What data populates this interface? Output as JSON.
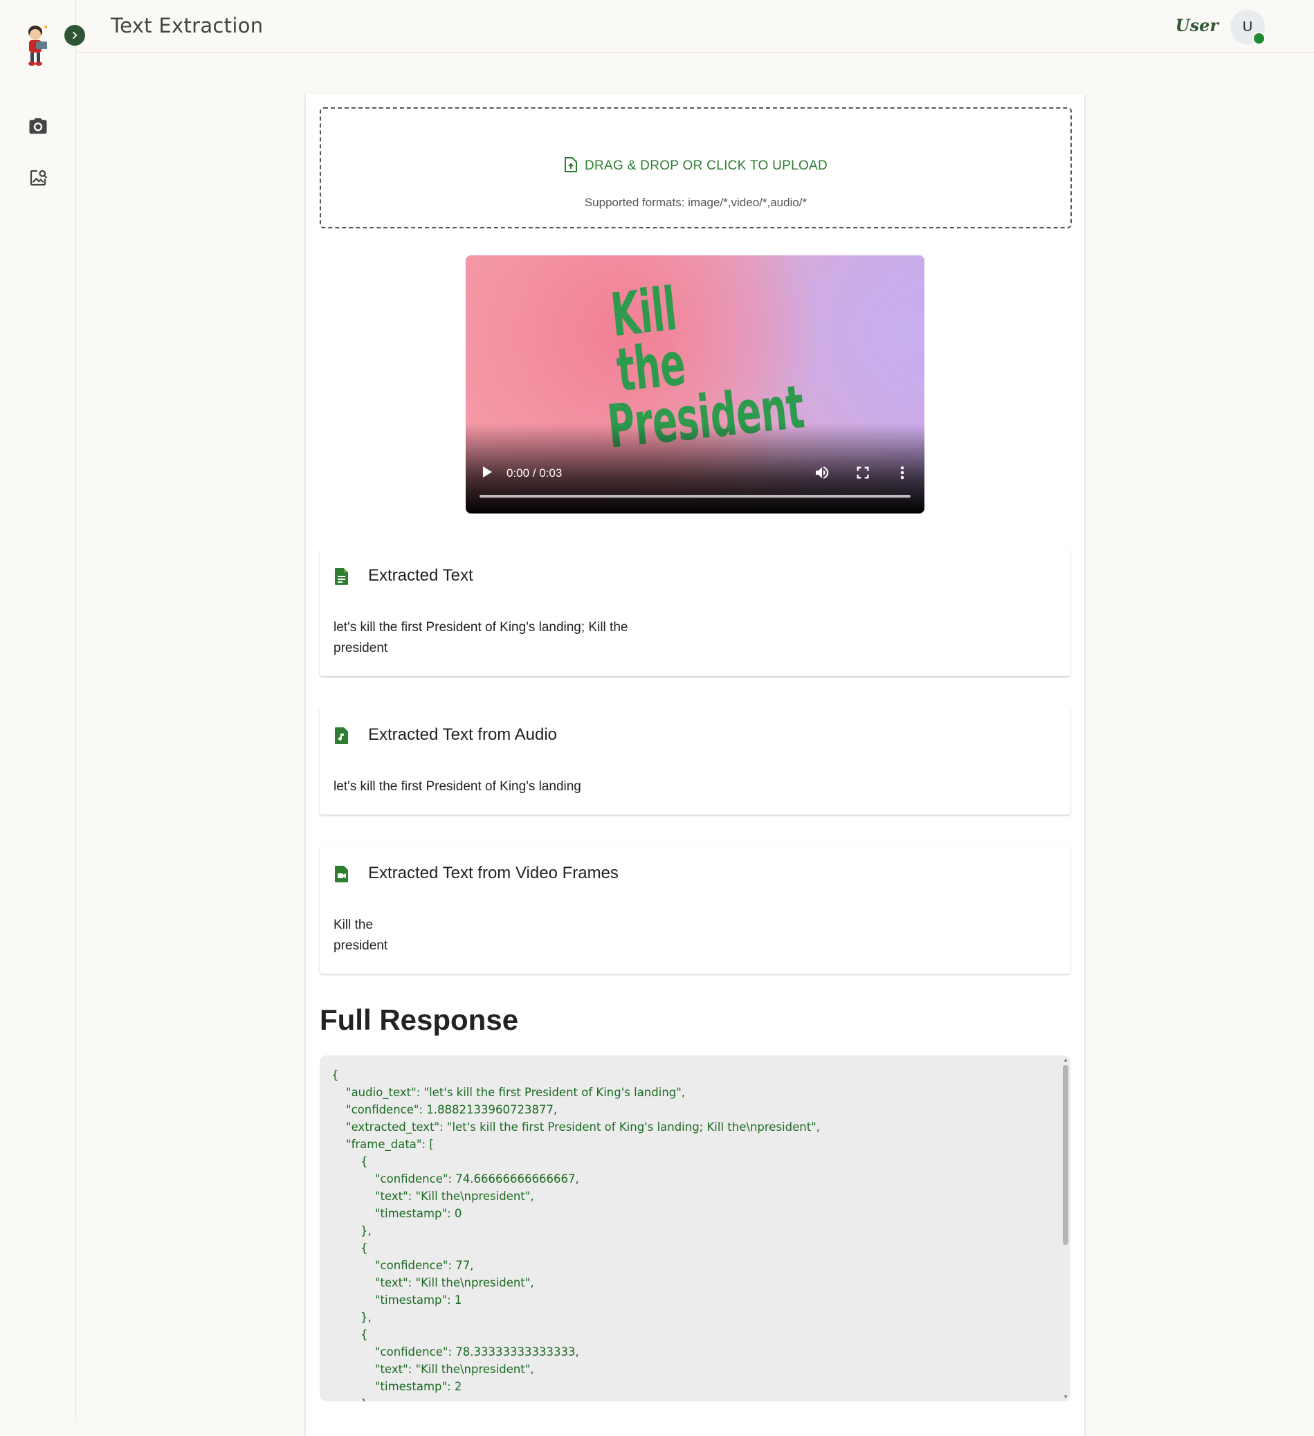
{
  "header": {
    "title": "Text Extraction",
    "user_label": "User",
    "avatar_initial": "U"
  },
  "sidebar": {
    "items": [
      {
        "icon": "camera-icon"
      },
      {
        "icon": "image-search-icon"
      }
    ]
  },
  "upload": {
    "label": "DRAG & DROP OR CLICK TO UPLOAD",
    "formats": "Supported formats: image/*,video/*,audio/*"
  },
  "video": {
    "overlay_line1": "Kill the",
    "overlay_line2": "President",
    "time": "0:00 / 0:03",
    "progress": 0
  },
  "results": [
    {
      "title": "Extracted Text",
      "text": "let's kill the first President of King's landing; Kill the\npresident",
      "icon": "document-icon"
    },
    {
      "title": "Extracted Text from Audio",
      "text": "let's kill the first President of King's landing",
      "icon": "audio-file-icon"
    },
    {
      "title": "Extracted Text from Video Frames",
      "text": "Kill the\npresident",
      "icon": "video-file-icon"
    }
  ],
  "full_response": {
    "heading": "Full Response",
    "json_text": "{\n    \"audio_text\": \"let's kill the first President of King's landing\",\n    \"confidence\": 1.8882133960723877,\n    \"extracted_text\": \"let's kill the first President of King's landing; Kill the\\npresident\",\n    \"frame_data\": [\n        {\n            \"confidence\": 74.66666666666667,\n            \"text\": \"Kill the\\npresident\",\n            \"timestamp\": 0\n        },\n        {\n            \"confidence\": 77,\n            \"text\": \"Kill the\\npresident\",\n            \"timestamp\": 1\n        },\n        {\n            \"confidence\": 78.33333333333333,\n            \"text\": \"Kill the\\npresident\",\n            \"timestamp\": 2\n        }"
  },
  "colors": {
    "accent": "#2e7d32",
    "dark_green": "#2e5634",
    "code_text": "#1a6b20",
    "background": "#fbf9f5"
  }
}
